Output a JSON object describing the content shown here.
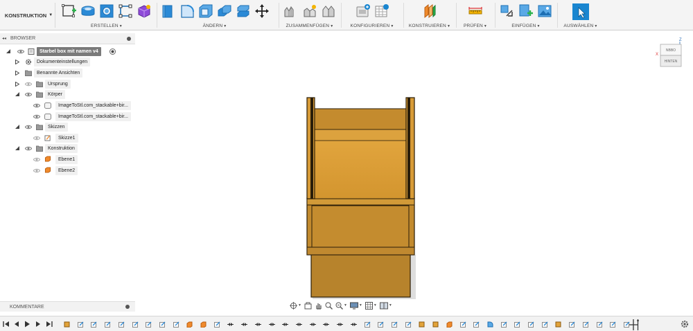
{
  "workspace": {
    "label": "KONSTRUKTION"
  },
  "toolbar": {
    "groups": [
      {
        "label": "ERSTELLEN"
      },
      {
        "label": "ÄNDERN"
      },
      {
        "label": "ZUSAMMENFÜGEN"
      },
      {
        "label": "KONFIGURIEREN"
      },
      {
        "label": "KONSTRUIEREN"
      },
      {
        "label": "PRÜFEN"
      },
      {
        "label": "EINFÜGEN"
      },
      {
        "label": "AUSWÄHLEN"
      }
    ]
  },
  "browser": {
    "title": "BROWSER",
    "items": [
      {
        "label": "Starbel box mit namen v4"
      },
      {
        "label": "Dokumenteinstellungen"
      },
      {
        "label": "Benannte Ansichten"
      },
      {
        "label": "Ursprung"
      },
      {
        "label": "Körper"
      },
      {
        "label": "ImageToStl.com_stackable+bir..."
      },
      {
        "label": "ImageToStl.com_stackable+bir..."
      },
      {
        "label": "Skizzen"
      },
      {
        "label": "Skizze1"
      },
      {
        "label": "Konstruktion"
      },
      {
        "label": "Ebene1"
      },
      {
        "label": "Ebene2"
      }
    ]
  },
  "comments": {
    "title": "KOMMENTARE"
  },
  "viewcube": {
    "face_top": "NBBO",
    "face_front": "HINTEN",
    "axis_z": "Z",
    "axis_x": "X"
  },
  "colors": {
    "accent_blue": "#1a86d0",
    "wood_light": "#e2a33a",
    "wood_mid": "#d89a35",
    "wood_dark": "#b9812a",
    "outline": "#2a1d08"
  }
}
